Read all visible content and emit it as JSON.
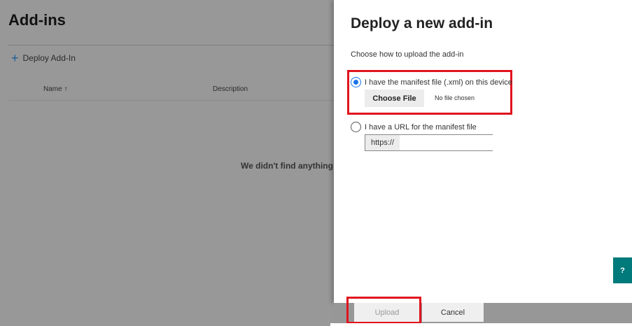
{
  "page": {
    "title": "Add-ins",
    "deploy_label": "Deploy Add-In",
    "columns": [
      "Name ↑",
      "Description"
    ],
    "empty_message": "We didn't find anything"
  },
  "panel": {
    "title": "Deploy a new add-in",
    "subtitle": "Choose how to upload the add-in",
    "option_file": {
      "label": "I have the manifest file (.xml) on this device",
      "selected": true,
      "choose_label": "Choose File",
      "status": "No file chosen"
    },
    "option_url": {
      "label": "I have a URL for the manifest file",
      "selected": false,
      "prefix": "https://",
      "value": ""
    },
    "upload_label": "Upload",
    "cancel_label": "Cancel",
    "help_icon": "question-circle-icon"
  },
  "colors": {
    "accent": "#1a73e8",
    "highlight": "#e0141e",
    "help": "#007a7a"
  }
}
